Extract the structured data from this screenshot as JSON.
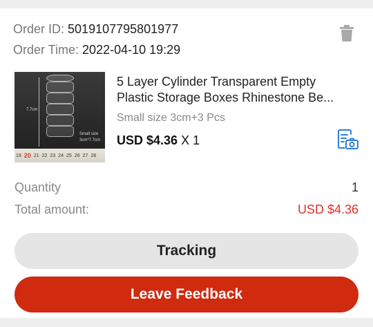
{
  "order": {
    "id_label": "Order ID:",
    "id_value": "5019107795801977",
    "time_label": "Order Time:",
    "time_value": "2022-04-10 19:29"
  },
  "product": {
    "title_line1": "5 Layer Cylinder Transparent Empty",
    "title_line2": "Plastic Storage Boxes Rhinestone Be...",
    "variant": "Small size 3cm+3 Pcs",
    "price": "USD $4.36",
    "qty_text": "X 1",
    "image": {
      "dim_label": "7.7cm",
      "size_label_1": "Small size",
      "size_label_2": "3cm*7.7cm",
      "ruler_marks": [
        "19",
        "20",
        "21",
        "22",
        "23",
        "24",
        "25",
        "26",
        "27",
        "28"
      ],
      "ruler_highlight": "20"
    }
  },
  "summary": {
    "quantity_label": "Quantity",
    "quantity_value": "1",
    "total_label": "Total amount:",
    "total_value": "USD $4.36"
  },
  "buttons": {
    "tracking": "Tracking",
    "feedback": "Leave Feedback"
  },
  "icons": {
    "delete": "trash-icon",
    "photo_review": "document-camera-icon"
  },
  "colors": {
    "accent_red": "#d02a0f",
    "price_red": "#e2302b",
    "icon_blue": "#2f7de1"
  }
}
